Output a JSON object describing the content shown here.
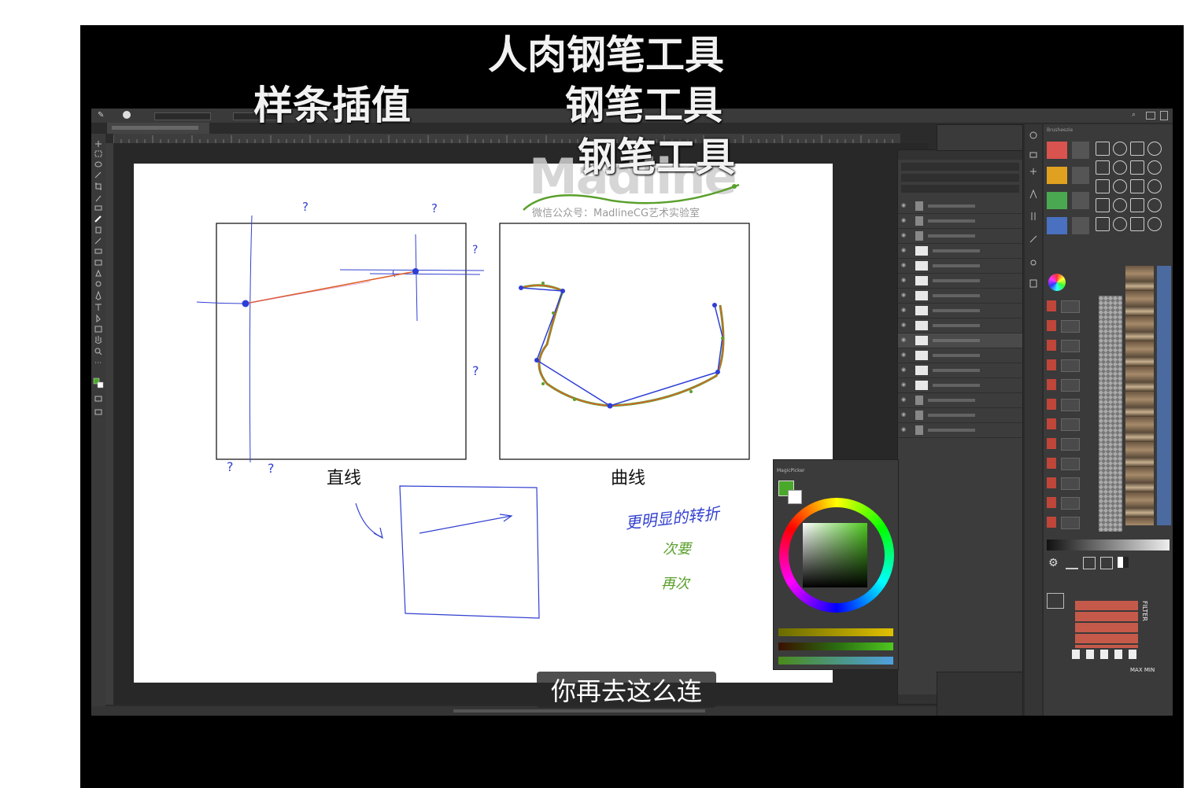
{
  "overlay": {
    "title_top": "人肉钢笔工具",
    "title_left": "样条插值",
    "title_mid1": "钢笔工具",
    "title_mid2": "钢笔工具",
    "watermark_logo": "Madline",
    "watermark_sub": "微信公众号：MadlineCG艺术实验室",
    "subtitle": "你再去这么连"
  },
  "canvas": {
    "label_straight": "直线",
    "label_curve": "曲线",
    "q_marks": [
      "?",
      "?",
      "?",
      "?",
      "?",
      "?"
    ],
    "handwriting_blue": "更明显的转折",
    "handwriting_green1": "次要",
    "handwriting_green2": "再次"
  },
  "colors": {
    "psBg": "#2b2b2b",
    "panel": "#3c3c3c",
    "canvas": "#ffffff",
    "blueStroke": "#2d3ed6",
    "orangeStroke": "#e0602a",
    "greenStroke": "#5aa02c",
    "activeFg": "#4aa82a"
  },
  "magic_picker": {
    "title": "MagicPicker"
  },
  "brushes_panel": {
    "title": "Brusheezie",
    "filter_label": "FILTER",
    "max_min": "MAX MIN"
  },
  "icons": [
    "brush-icon",
    "move-icon",
    "marquee-icon",
    "lasso-icon",
    "crop-icon",
    "eyedropper-icon",
    "eraser-icon",
    "pen-icon",
    "text-icon",
    "hand-icon",
    "zoom-icon",
    "eye-icon",
    "folder-icon",
    "gear-icon",
    "color-wheel-icon",
    "search-icon"
  ]
}
